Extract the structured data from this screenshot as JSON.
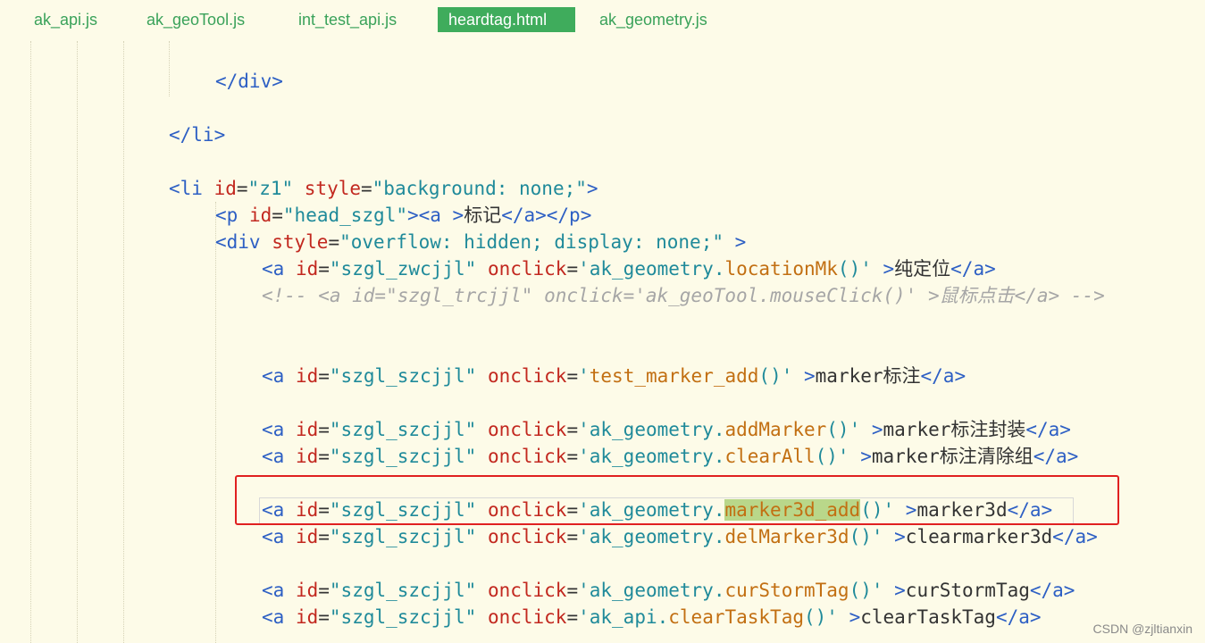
{
  "tabs": [
    {
      "label": "ak_api.js",
      "active": false
    },
    {
      "label": "ak_geoTool.js",
      "active": false
    },
    {
      "label": "int_test_api.js",
      "active": false
    },
    {
      "label": "heardtag.html",
      "active": true
    },
    {
      "label": "ak_geometry.js",
      "active": false
    }
  ],
  "code": {
    "div_close": "</div>",
    "li_close": "</li>",
    "li_open": {
      "tag": "<li",
      "id_attr": "id",
      "eq": "=",
      "id_val": "\"z1\"",
      "style_attr": "style",
      "style_val": "\"background: none;\"",
      "close": ">"
    },
    "p_line": {
      "open": "<p",
      "id_attr": "id",
      "eq": "=",
      "id_val": "\"head_szgl\"",
      "a_open": "><a >",
      "text": "标记",
      "close": "</a></p>"
    },
    "div_open": {
      "tag": "<div",
      "style_attr": "style",
      "eq": "=",
      "style_val": "\"overflow: hidden; display: none;\"",
      "close": " >"
    },
    "a_lines": [
      {
        "id_val": "\"szgl_zwcjjl\"",
        "obj": "'ak_geometry.",
        "fn": "locationMk",
        "end": "()'",
        "text": "纯定位"
      },
      {
        "id_val": "\"szgl_szcjjl\"",
        "obj": "'",
        "fn": "test_marker_add",
        "end": "()'",
        "text": "marker标注"
      },
      {
        "id_val": "\"szgl_szcjjl\"",
        "obj": "'ak_geometry.",
        "fn": "addMarker",
        "end": "()'",
        "text": "marker标注封装"
      },
      {
        "id_val": "\"szgl_szcjjl\"",
        "obj": "'ak_geometry.",
        "fn": "clearAll",
        "end": "()'",
        "text": "marker标注清除组"
      },
      {
        "id_val": "\"szgl_szcjjl\"",
        "obj": "'ak_geometry.",
        "fn": "marker3d_add",
        "end": "()'",
        "text": "marker3d"
      },
      {
        "id_val": "\"szgl_szcjjl\"",
        "obj": "'ak_geometry.",
        "fn": "delMarker3d",
        "end": "()'",
        "text": "clearmarker3d"
      },
      {
        "id_val": "\"szgl_szcjjl\"",
        "obj": "'ak_geometry.",
        "fn": "curStormTag",
        "end": "()'",
        "text": "curStormTag"
      },
      {
        "id_val": "\"szgl_szcjjl\"",
        "obj": "'ak_api.",
        "fn": "clearTaskTag",
        "end": "()'",
        "text": "clearTaskTag"
      }
    ],
    "a_tag": "<a",
    "id_attr": "id",
    "onclick_attr": "onclick",
    "eq": "=",
    "gt": " >",
    "a_close": "</a>",
    "comment": "<!-- <a id=\"szgl_trcjjl\" onclick='ak_geoTool.mouseClick()' >鼠标点击</a> -->"
  },
  "watermark": "CSDN @zjltianxin"
}
